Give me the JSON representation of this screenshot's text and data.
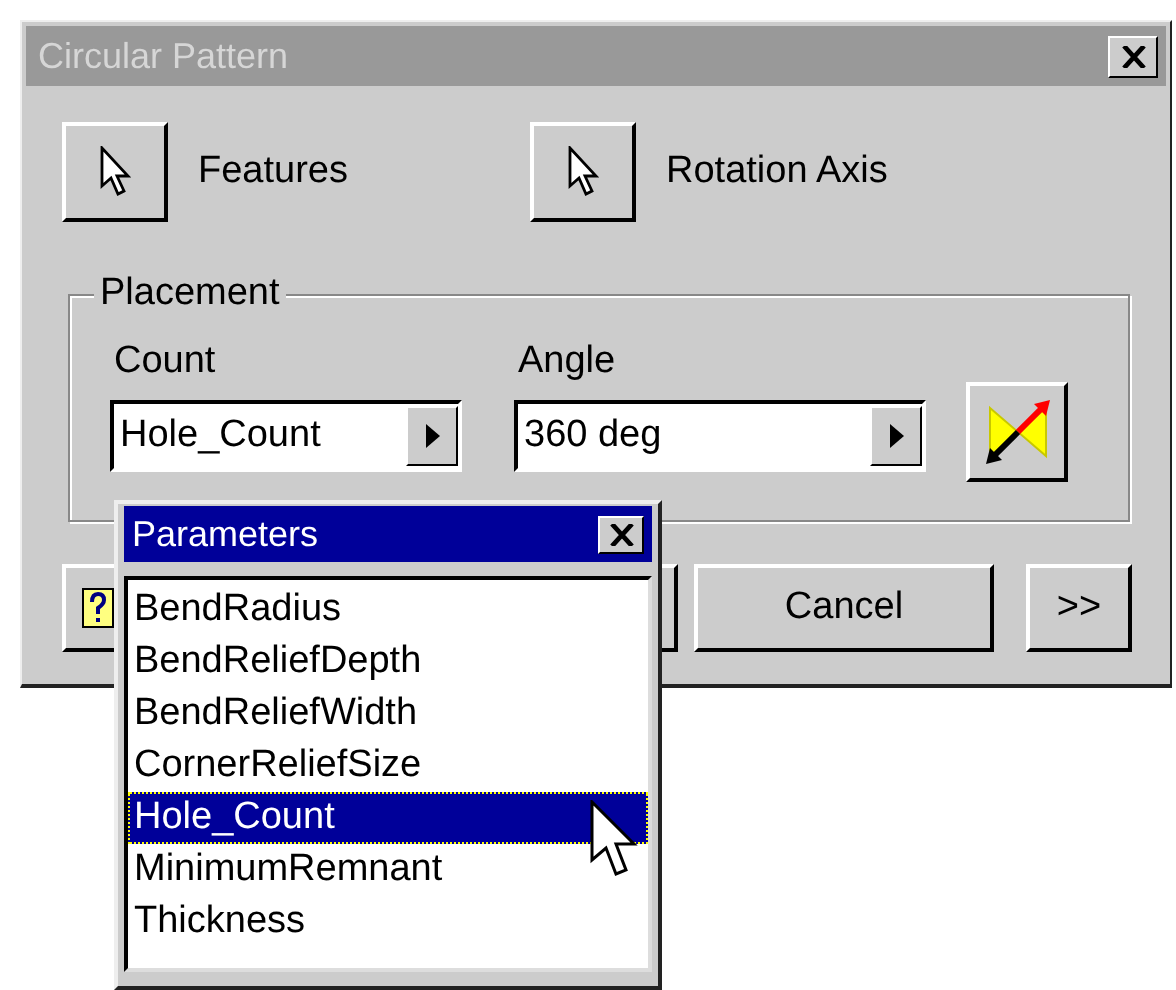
{
  "window": {
    "title": "Circular Pattern"
  },
  "selectors": [
    {
      "label": "Features"
    },
    {
      "label": "Rotation Axis"
    }
  ],
  "placement": {
    "title": "Placement",
    "fields": [
      {
        "label": "Count",
        "value": "Hole_Count",
        "kind": "short"
      },
      {
        "label": "Angle",
        "value": "360 deg",
        "kind": "wide"
      }
    ]
  },
  "buttons": [
    {
      "kind": "help"
    },
    {
      "kind": "hidden"
    },
    {
      "kind": "text",
      "label": "Cancel"
    },
    {
      "kind": "more",
      "label": ">>"
    }
  ],
  "parameters_popup": {
    "title": "Parameters",
    "items": [
      {
        "label": "BendRadius",
        "selected": false
      },
      {
        "label": "BendReliefDepth",
        "selected": false
      },
      {
        "label": "BendReliefWidth",
        "selected": false
      },
      {
        "label": "CornerReliefSize",
        "selected": false
      },
      {
        "label": "Hole_Count",
        "selected": true
      },
      {
        "label": "MinimumRemnant",
        "selected": false
      },
      {
        "label": "Thickness",
        "selected": false
      }
    ]
  }
}
